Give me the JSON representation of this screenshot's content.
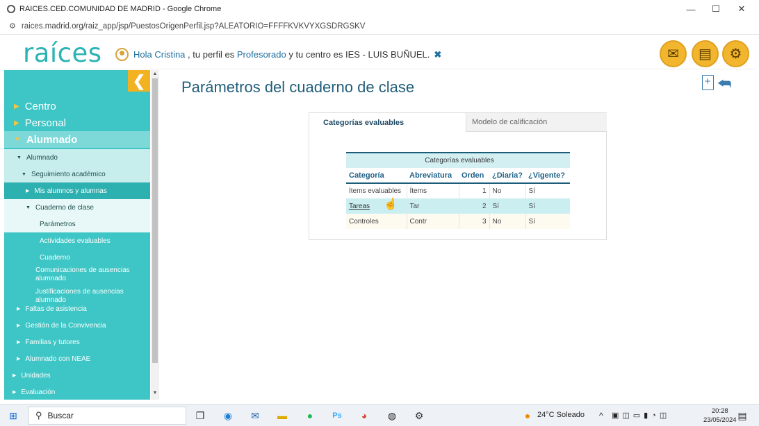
{
  "window": {
    "title": "RAICES.CED.COMUNIDAD DE MADRID - Google Chrome",
    "url": "raices.madrid.org/raiz_app/jsp/PuestosOrigenPerfil.jsp?ALEATORIO=FFFFKVKVYXGSDRGSKV"
  },
  "header": {
    "logo": "raíces",
    "greeting": "Hola Cristina",
    "profile_prefix": ", tu perfil es",
    "profile": "Profesorado",
    "center_prefix": "y tu centro es",
    "center": "IES - LUIS BUÑUEL.",
    "close_icon": "✖",
    "buttons": [
      {
        "icon": "mail-icon",
        "glyph": "✉"
      },
      {
        "icon": "documents-icon",
        "glyph": "▤"
      },
      {
        "icon": "settings-icon",
        "glyph": "⚙"
      }
    ]
  },
  "sidebar": {
    "collapse_glyph": "❮",
    "items": [
      {
        "label": "Centro"
      },
      {
        "label": "Personal"
      },
      {
        "label": "Alumnado"
      },
      {
        "label": "Alumnado"
      },
      {
        "label": "Seguimiento académico"
      },
      {
        "label": "Mis alumnos y alumnas"
      },
      {
        "label": "Cuaderno de clase"
      },
      {
        "label": "Parámetros"
      },
      {
        "label": "Actividades evaluables"
      },
      {
        "label": "Cuaderno"
      },
      {
        "label": "Comunicaciones de ausencias alumnado"
      },
      {
        "label": "Justificaciones de ausencias alumnado"
      },
      {
        "label": "Faltas de asistencia"
      },
      {
        "label": "Gestión de la Convivencia"
      },
      {
        "label": "Familias y tutores"
      },
      {
        "label": "Alumnado con NEAE"
      },
      {
        "label": "Unidades"
      },
      {
        "label": "Evaluación"
      }
    ]
  },
  "main": {
    "title": "Parámetros del cuaderno de clase",
    "tabs": [
      {
        "label": "Categorías evaluables",
        "active": true
      },
      {
        "label": "Modelo de calificación",
        "active": false
      }
    ],
    "table": {
      "caption": "Categorías evaluables",
      "headers": [
        "Categoría",
        "Abreviatura",
        "Orden",
        "¿Diaria?",
        "¿Vigente?"
      ],
      "rows": [
        [
          "Ítems evaluables",
          "Ítems",
          "1",
          "No",
          "Sí"
        ],
        [
          "Tareas",
          "Tar",
          "2",
          "Sí",
          "Sí"
        ],
        [
          "Controles",
          "Contr",
          "3",
          "No",
          "Sí"
        ]
      ]
    }
  },
  "taskbar": {
    "search_placeholder": "Buscar",
    "weather": "24°C Soleado",
    "time": "20:28",
    "date": "23/05/2024"
  },
  "colors": {
    "sidebar": "#3ec5c5",
    "accent": "#f3b221",
    "title": "#215e7a",
    "table_border": "#1b5d79"
  }
}
